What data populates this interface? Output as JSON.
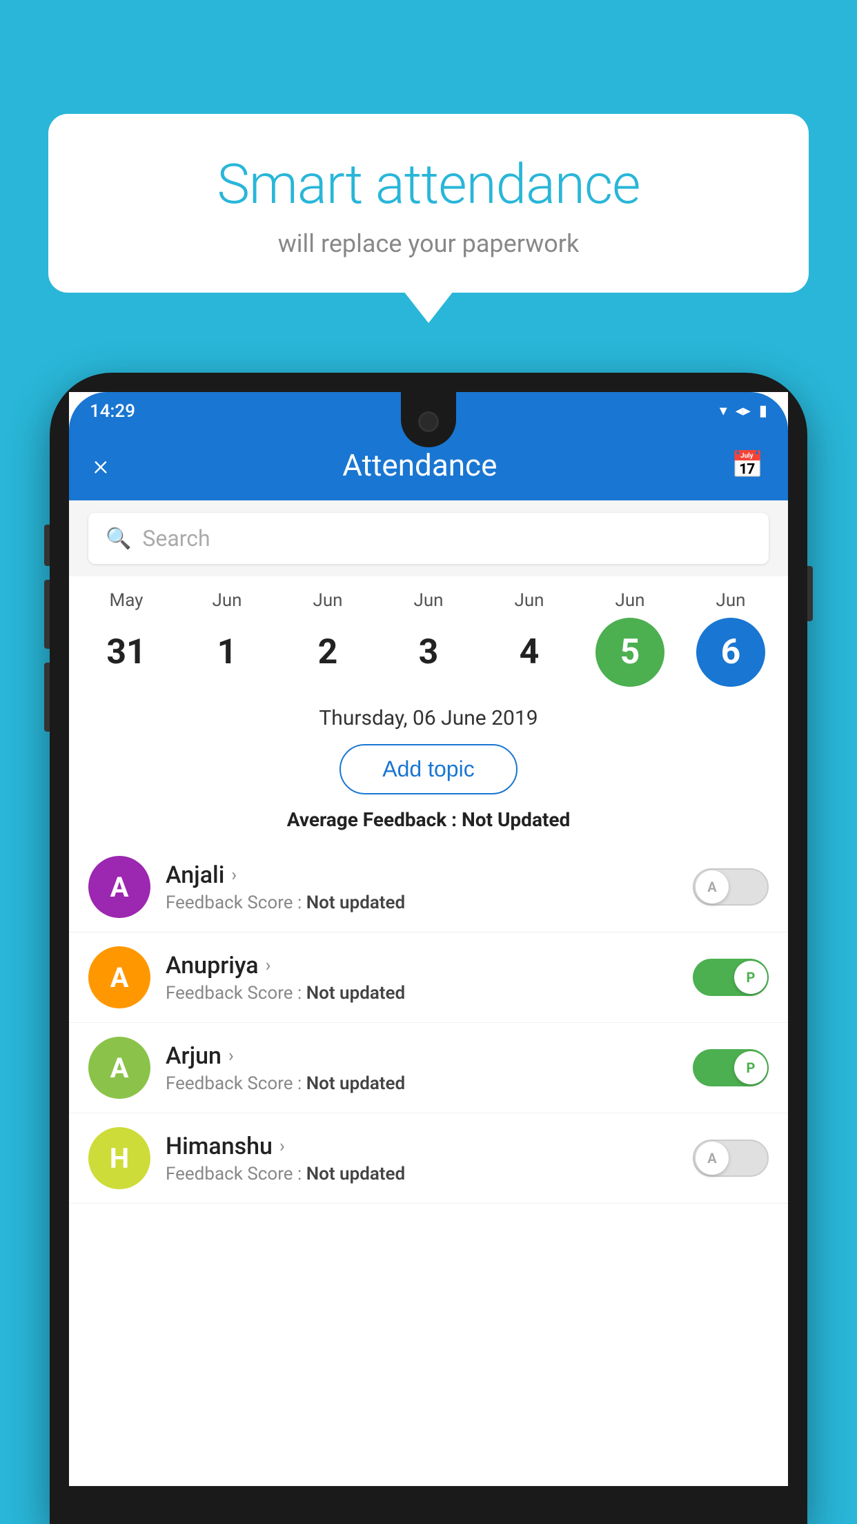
{
  "background_color": "#29B6D8",
  "bubble": {
    "title": "Smart attendance",
    "subtitle": "will replace your paperwork"
  },
  "status_bar": {
    "time": "14:29",
    "icons": [
      "wifi",
      "signal",
      "battery"
    ]
  },
  "header": {
    "title": "Attendance",
    "close_label": "×",
    "calendar_icon": "📅"
  },
  "search": {
    "placeholder": "Search"
  },
  "calendar": {
    "days": [
      {
        "month": "May",
        "date": "31",
        "selected": ""
      },
      {
        "month": "Jun",
        "date": "1",
        "selected": ""
      },
      {
        "month": "Jun",
        "date": "2",
        "selected": ""
      },
      {
        "month": "Jun",
        "date": "3",
        "selected": ""
      },
      {
        "month": "Jun",
        "date": "4",
        "selected": ""
      },
      {
        "month": "Jun",
        "date": "5",
        "selected": "green"
      },
      {
        "month": "Jun",
        "date": "6",
        "selected": "blue"
      }
    ]
  },
  "selected_date": "Thursday, 06 June 2019",
  "add_topic_label": "Add topic",
  "average_feedback": {
    "label": "Average Feedback : ",
    "value": "Not Updated"
  },
  "students": [
    {
      "name": "Anjali",
      "initial": "A",
      "avatar_color": "purple",
      "feedback_label": "Feedback Score : ",
      "feedback_value": "Not updated",
      "toggle": "off",
      "toggle_letter": "A"
    },
    {
      "name": "Anupriya",
      "initial": "A",
      "avatar_color": "orange",
      "feedback_label": "Feedback Score : ",
      "feedback_value": "Not updated",
      "toggle": "on",
      "toggle_letter": "P"
    },
    {
      "name": "Arjun",
      "initial": "A",
      "avatar_color": "green",
      "feedback_label": "Feedback Score : ",
      "feedback_value": "Not updated",
      "toggle": "on",
      "toggle_letter": "P"
    },
    {
      "name": "Himanshu",
      "initial": "H",
      "avatar_color": "lime",
      "feedback_label": "Feedback Score : ",
      "feedback_value": "Not updated",
      "toggle": "off",
      "toggle_letter": "A"
    }
  ]
}
